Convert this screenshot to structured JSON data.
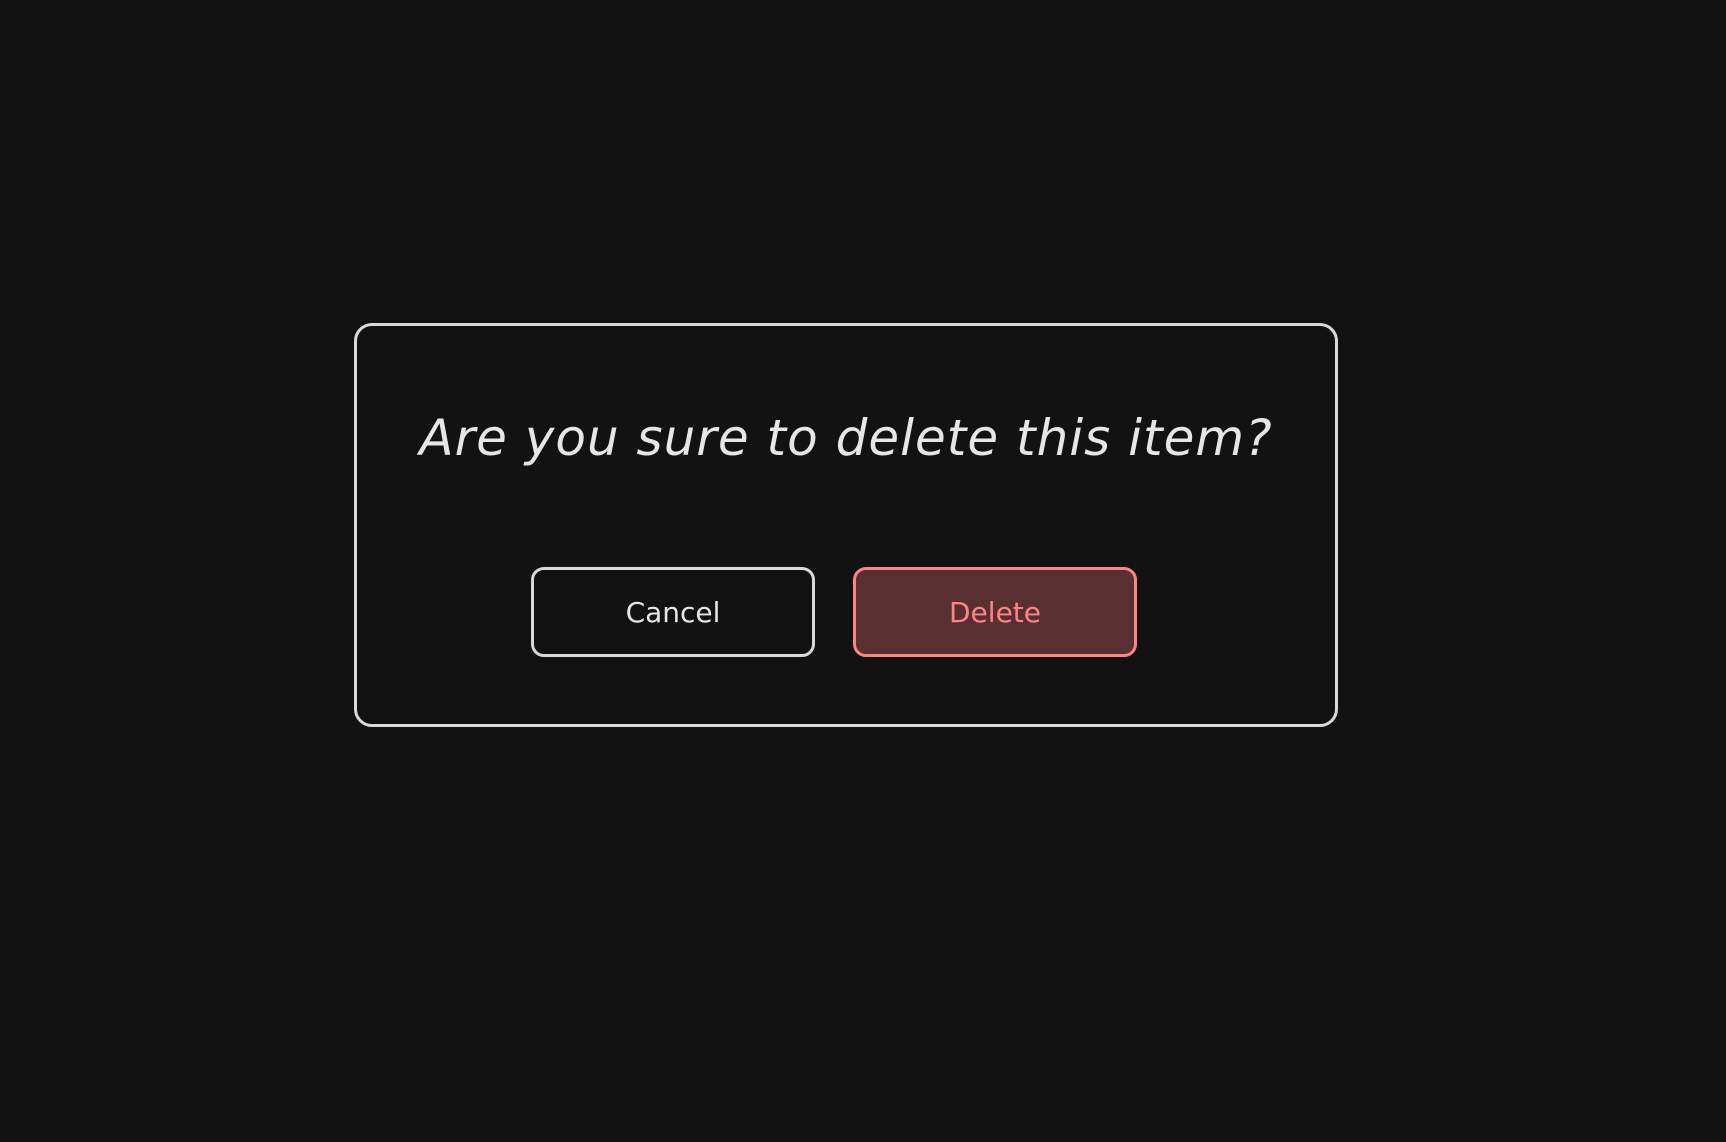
{
  "dialog": {
    "message": "Are you sure to delete this item?",
    "cancel_label": "Cancel",
    "delete_label": "Delete"
  },
  "colors": {
    "background": "#121212",
    "border": "#d9d9d9",
    "text": "#e6e6e6",
    "danger": "#ff8383",
    "danger_fill": "#593031"
  }
}
